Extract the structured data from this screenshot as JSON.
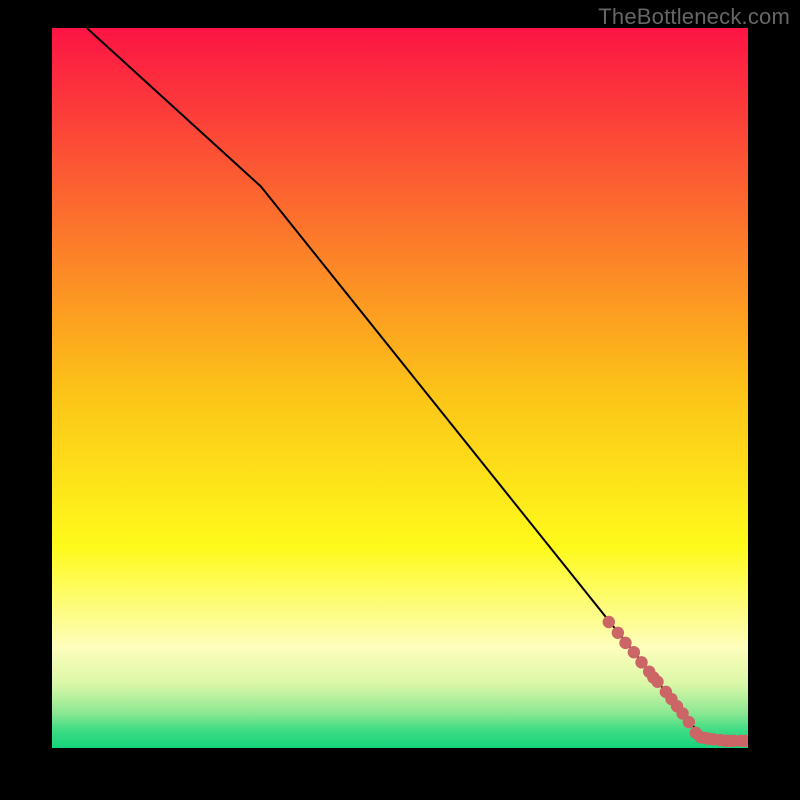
{
  "watermark": "TheBottleneck.com",
  "chart_data": {
    "type": "line",
    "title": "",
    "xlabel": "",
    "ylabel": "",
    "xlim": [
      0,
      100
    ],
    "ylim": [
      0,
      100
    ],
    "grid": false,
    "line": {
      "name": "curve",
      "points": [
        {
          "x": 5,
          "y": 100
        },
        {
          "x": 30,
          "y": 78
        },
        {
          "x": 93,
          "y": 2
        },
        {
          "x": 100,
          "y": 1
        }
      ]
    },
    "overlay_points": {
      "name": "highlighted",
      "color": "#cc6666",
      "data": [
        {
          "x": 80.0,
          "y": 17.5
        },
        {
          "x": 81.3,
          "y": 16.0
        },
        {
          "x": 82.4,
          "y": 14.6
        },
        {
          "x": 83.6,
          "y": 13.3
        },
        {
          "x": 84.7,
          "y": 11.9
        },
        {
          "x": 85.8,
          "y": 10.6
        },
        {
          "x": 86.4,
          "y": 9.8
        },
        {
          "x": 87.0,
          "y": 9.2
        },
        {
          "x": 88.2,
          "y": 7.8
        },
        {
          "x": 89.0,
          "y": 6.8
        },
        {
          "x": 89.8,
          "y": 5.8
        },
        {
          "x": 90.6,
          "y": 4.8
        },
        {
          "x": 91.5,
          "y": 3.6
        },
        {
          "x": 92.5,
          "y": 2.1
        },
        {
          "x": 93.2,
          "y": 1.5
        },
        {
          "x": 93.8,
          "y": 1.4
        },
        {
          "x": 94.3,
          "y": 1.3
        },
        {
          "x": 95.0,
          "y": 1.2
        },
        {
          "x": 96.0,
          "y": 1.1
        },
        {
          "x": 96.8,
          "y": 1.0
        },
        {
          "x": 97.3,
          "y": 1.0
        },
        {
          "x": 98.0,
          "y": 1.0
        },
        {
          "x": 99.0,
          "y": 1.0
        },
        {
          "x": 99.7,
          "y": 1.0
        }
      ]
    },
    "gradient_bg": {
      "stops": [
        {
          "offset": 0.0,
          "color": "#fc1444"
        },
        {
          "offset": 0.25,
          "color": "#fc6b2e"
        },
        {
          "offset": 0.5,
          "color": "#fcc218"
        },
        {
          "offset": 0.72,
          "color": "#fefa1a"
        },
        {
          "offset": 0.86,
          "color": "#fdfebc"
        },
        {
          "offset": 0.91,
          "color": "#dcf7a8"
        },
        {
          "offset": 0.95,
          "color": "#8fe993"
        },
        {
          "offset": 0.975,
          "color": "#3fdc84"
        },
        {
          "offset": 1.0,
          "color": "#15d47b"
        }
      ]
    }
  }
}
